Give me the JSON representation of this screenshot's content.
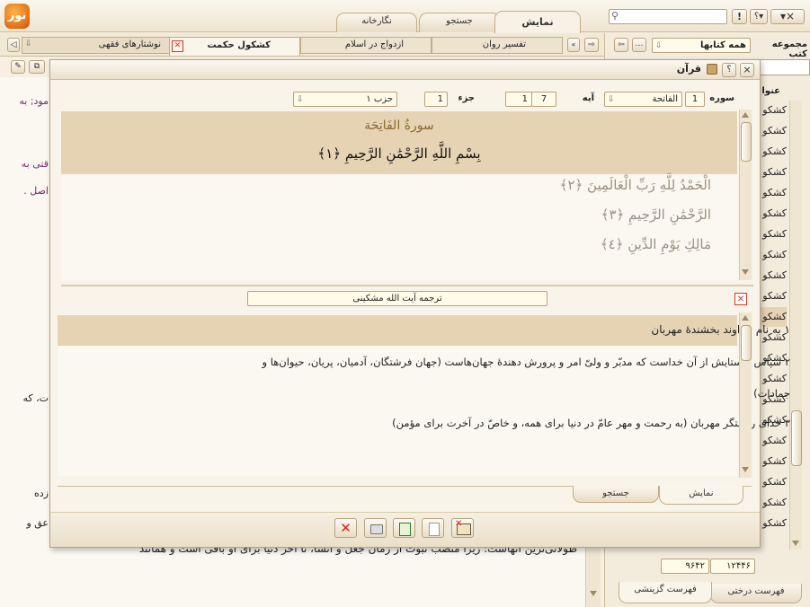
{
  "app": {
    "logo": "نور",
    "top_tabs": [
      "نمایش",
      "جستجو",
      "نگارخانه"
    ]
  },
  "window_buttons": {
    "close": "×",
    "help": "؟",
    "alert": "!"
  },
  "doc_tabs": [
    "کشکول حکمت",
    "ازدواج در اسلام",
    "تفسیر روان",
    "نوشتارهای فقهی"
  ],
  "left_panel": {
    "collection_label": "مجموعه کتب",
    "collection_value": "همه کتابها",
    "title_label": "عنوا",
    "list_items": [
      "کشکو",
      "کشکو",
      "کشکو",
      "کشکو",
      "کشکو",
      "کشکو",
      "کشکو",
      "کشکو",
      "کشکو",
      "کشکو",
      "کشکو",
      "کشکو",
      "کشکو",
      "کشکو",
      "کشکو",
      "کشکو",
      "کشکو",
      "کشکو",
      "کشکو",
      "کشکو",
      "کشکو",
      "کشکو"
    ],
    "counts": [
      "۱۲۴۴۶",
      "۹۶۴۲"
    ],
    "bottom_tabs": [
      "فهرست درختی",
      "فهرست گزینشی"
    ]
  },
  "background_text": [
    "مود; به",
    "قتی به",
    "اصل .",
    "ت، که",
    "زده",
    "عق و",
    "طولانی‌ترین آنهاست؛ زیرا منصب نبوت از زمان جعل و انشا، تا آخر دنیا برای او باقی است و همانند"
  ],
  "dialog": {
    "title": "قرآن",
    "surah_label": "سوره",
    "surah_number": "1",
    "surah_name": "الفاتحة",
    "ayah_label": "آیه",
    "ayah_value": "1",
    "ayah_total": "7",
    "juz_label": "جزء",
    "juz_value": "1",
    "hizb_value": "حزب ۱",
    "quran_title": "سورةُ الفَاتِحَة",
    "verses": [
      "بِسْمِ اللَّهِ الرَّحْمَٰنِ الرَّحِيمِ ﴿١﴾",
      "الْحَمْدُ لِلَّهِ رَبِّ الْعَالَمِينَ ﴿٢﴾",
      "الرَّحْمَٰنِ الرَّحِيمِ ﴿٣﴾",
      "مَالِكِ يَوْمِ الدِّينِ ﴿٤﴾"
    ],
    "translator": "ترجمه آیت الله مشکینی",
    "translation": [
      "۱ به نام خداوند بخشندهٔ مهربان",
      "۲ سپاس و ستایش از آن خداست که مدبّر و ولیّ امر و پرورش دهندهٔ جهان‌هاست (جهان فرشتگان، آدمیان، پریان، حیوان‌ها و",
      "جمادات)",
      "۳ خدای رحمتگر مهربان (به رحمت و مهر عامّ در دنیا برای همه، و خاصّ در آخرت برای مؤمن)"
    ],
    "bottom_tabs": [
      "نمایش",
      "جستجو"
    ]
  },
  "colors": {
    "highlight": "#e6d3b3",
    "accent": "#e07820"
  }
}
